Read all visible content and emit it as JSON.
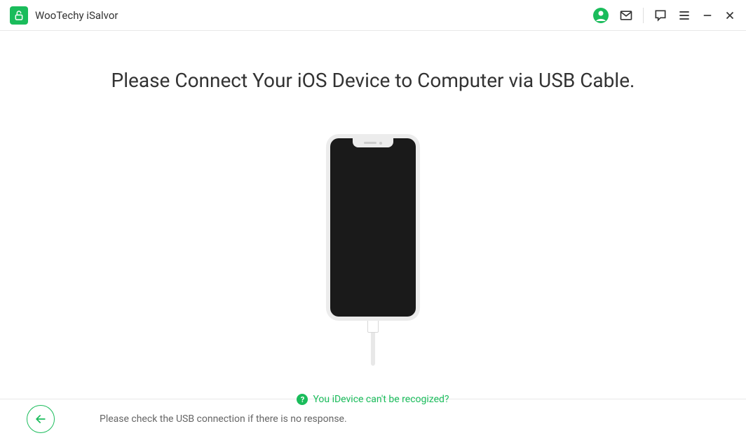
{
  "header": {
    "app_title": "WooTechy iSalvor"
  },
  "main": {
    "instruction_title": "Please Connect Your iOS Device to Computer via USB Cable.",
    "help_link_text": "You iDevice can't be recogized?"
  },
  "footer": {
    "hint_text": "Please check the USB connection if there is no response."
  },
  "colors": {
    "accent": "#1abc5b"
  }
}
